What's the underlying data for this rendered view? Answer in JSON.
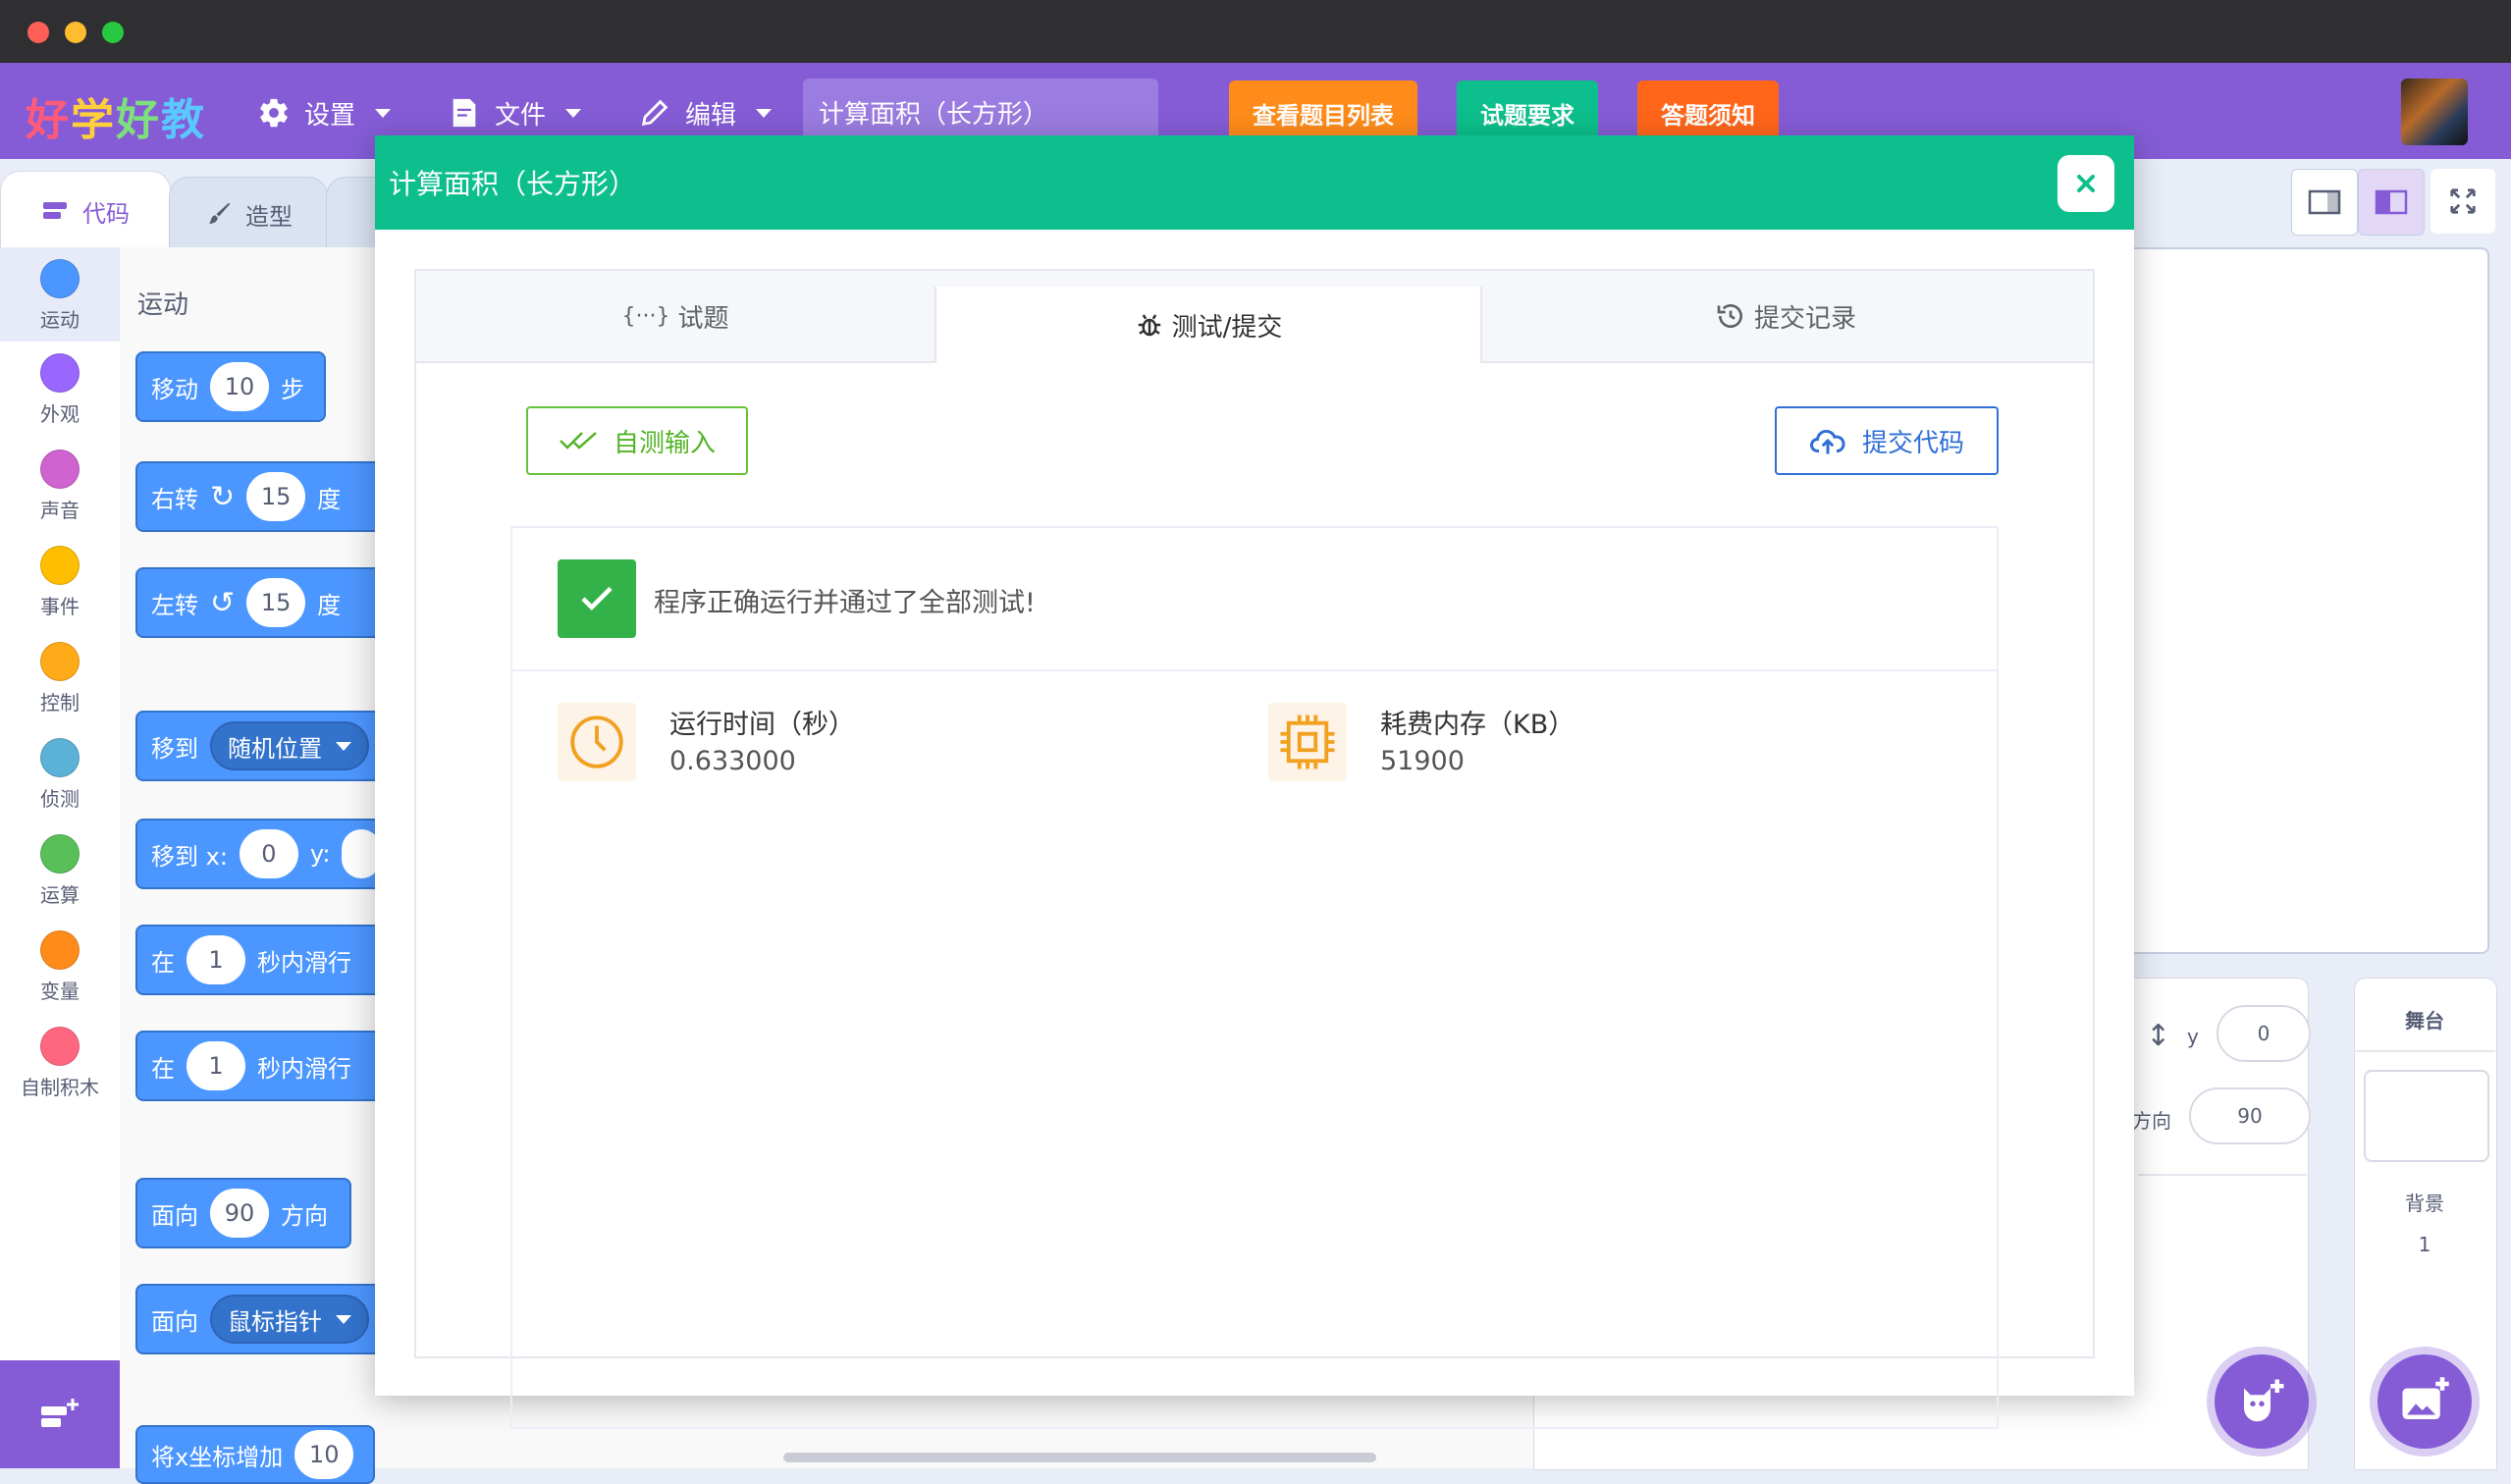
{
  "app": {
    "logo_text": "好学好教",
    "menu": {
      "settings": "设置",
      "file": "文件",
      "edit": "编辑"
    },
    "project_title": "计算面积（长方形）",
    "buttons": {
      "problem_list": "查看题目列表",
      "requirements": "试题要求",
      "notice": "答题须知"
    }
  },
  "left_panel": {
    "tabs": {
      "code": "代码",
      "costume": "造型"
    },
    "categories": [
      {
        "label": "运动",
        "color": "#4c97ff"
      },
      {
        "label": "外观",
        "color": "#9966ff"
      },
      {
        "label": "声音",
        "color": "#cf63cf"
      },
      {
        "label": "事件",
        "color": "#ffbf00"
      },
      {
        "label": "控制",
        "color": "#ffab19"
      },
      {
        "label": "侦测",
        "color": "#5cb1d6"
      },
      {
        "label": "运算",
        "color": "#59c059"
      },
      {
        "label": "变量",
        "color": "#ff8c1a"
      },
      {
        "label": "自制积木",
        "color": "#ff6680"
      }
    ],
    "palette_title": "运动",
    "blocks": {
      "move": {
        "pre": "移动",
        "val": "10",
        "post": "步"
      },
      "turn_right": {
        "pre": "右转",
        "val": "15",
        "post": "度"
      },
      "turn_left": {
        "pre": "左转",
        "val": "15",
        "post": "度"
      },
      "goto": {
        "pre": "移到",
        "drop": "随机位置"
      },
      "goto_xy": {
        "pre": "移到 x:",
        "x": "0",
        "y_label": "y:"
      },
      "glide1": {
        "pre": "在",
        "val": "1",
        "post": "秒内滑行"
      },
      "glide2": {
        "pre": "在",
        "val": "1",
        "post": "秒内滑行"
      },
      "point_dir": {
        "pre": "面向",
        "val": "90",
        "post": "方向"
      },
      "point_to": {
        "pre": "面向",
        "drop": "鼠标指针"
      },
      "change_x": {
        "pre": "将x坐标增加",
        "val": "10"
      }
    }
  },
  "stage_area": {
    "sprite_info": {
      "y_label": "y",
      "y_value": "0",
      "direction_label": "方向",
      "direction_value": "90"
    },
    "stage_panel": {
      "title": "舞台",
      "backdrop_label": "背景",
      "backdrop_count": "1"
    }
  },
  "modal": {
    "title": "计算面积（长方形）",
    "tabs": [
      {
        "label": "试题",
        "icon": "braces-icon"
      },
      {
        "label": "测试/提交",
        "icon": "bug-icon"
      },
      {
        "label": "提交记录",
        "icon": "history-icon"
      }
    ],
    "self_test_button": "自测输入",
    "submit_button": "提交代码",
    "result_message": "程序正确运行并通过了全部测试!",
    "metrics": {
      "time_label": "运行时间（秒）",
      "time_value": "0.633000",
      "memory_label": "耗费内存（KB）",
      "memory_value": "51900"
    }
  },
  "colors": {
    "menubar": "#855cd6",
    "modal_header": "#0dbf8c",
    "success": "#34b24a",
    "btn_orange": "#ff8c1a",
    "btn_green": "#0dbf8c",
    "btn_red": "#ff661a"
  }
}
